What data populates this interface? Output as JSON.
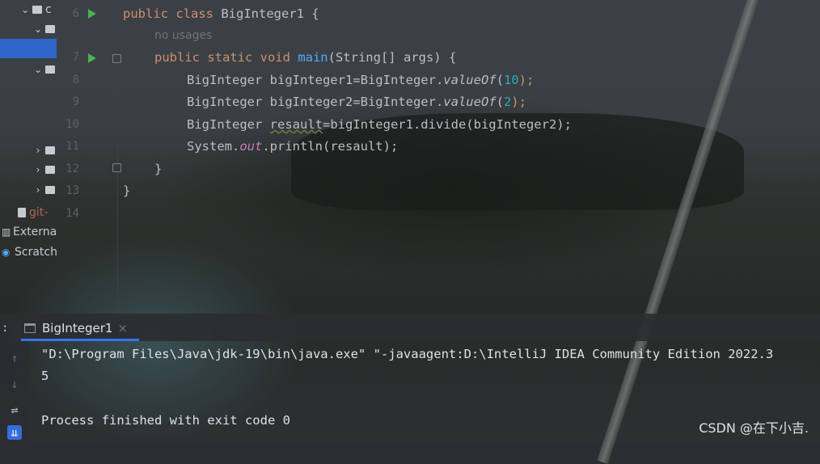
{
  "project_panel": {
    "items": [
      {
        "label": "c",
        "expanded": true
      },
      {
        "label": "",
        "expanded": true
      },
      {
        "label": "",
        "expanded": true
      },
      {
        "label": "",
        "expanded": false
      },
      {
        "label": "",
        "expanded": false
      },
      {
        "label": "",
        "expanded": false
      },
      {
        "label": "git-"
      },
      {
        "label": "Externa"
      },
      {
        "label": "Scratch"
      }
    ]
  },
  "editor": {
    "line_numbers": [
      "6",
      "7",
      "8",
      "9",
      "10",
      "11",
      "12",
      "13",
      "14"
    ],
    "inlay_hint": "no usages",
    "code": {
      "l6_kw": "public class ",
      "l6_rest": "BigInteger1 {",
      "l7_kw": "public static void ",
      "l7_fn": "main",
      "l7_rest": "(String[] args) {",
      "l8_a": "BigInteger bigInteger1=BigInteger.",
      "l8_m": "valueOf",
      "l8_b": "(",
      "l8_n": "10",
      "l8_c": ");",
      "l9_a": "BigInteger bigInteger2=BigInteger.",
      "l9_m": "valueOf",
      "l9_b": "(",
      "l9_n": "2",
      "l9_c": ");",
      "l10_a": "BigInteger ",
      "l10_var": "resault",
      "l10_b": "=bigInteger1.divide(bigInteger2);",
      "l11_a": "System.",
      "l11_f": "out",
      "l11_b": ".println(resault);",
      "l12": "}",
      "l13": "}"
    }
  },
  "run_panel": {
    "tab_label": "BigInteger1",
    "close_glyph": "×",
    "console": [
      "\"D:\\Program Files\\Java\\jdk-19\\bin\\java.exe\" \"-javaagent:D:\\IntelliJ IDEA Community Edition 2022.3",
      "5",
      "",
      "Process finished with exit code 0"
    ]
  },
  "watermark": "CSDN @在下小吉."
}
